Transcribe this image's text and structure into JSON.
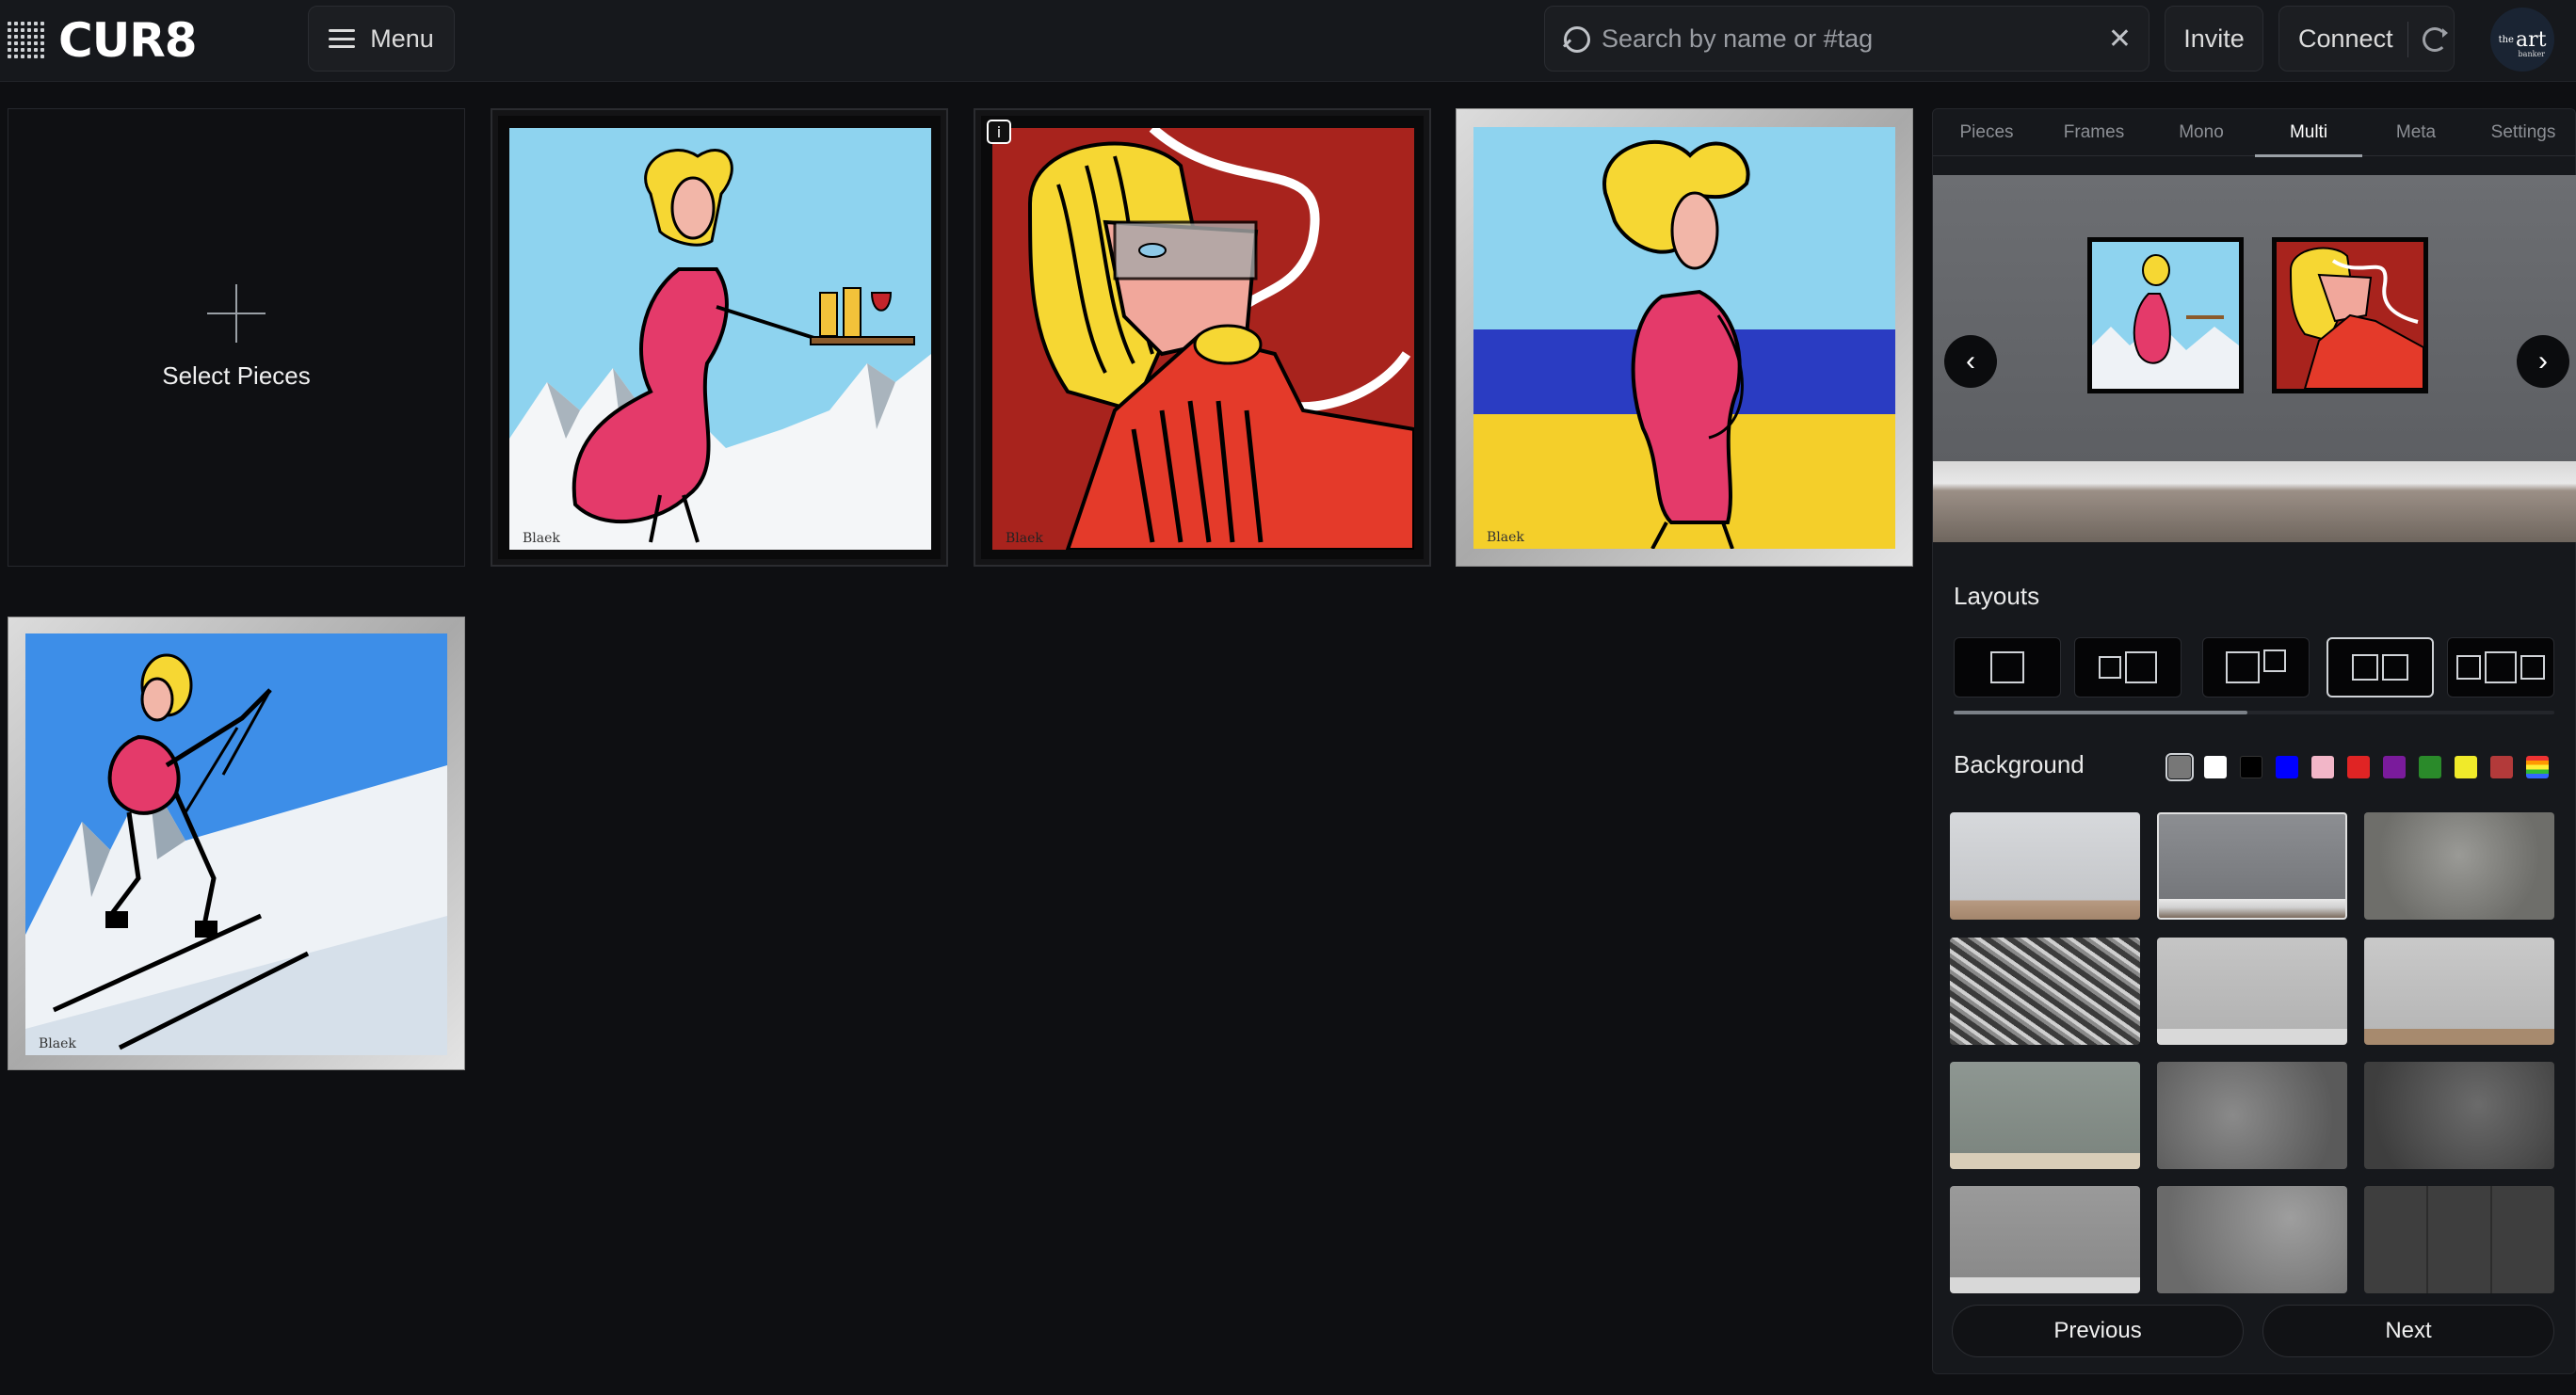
{
  "app": {
    "logo_text": "CUR8"
  },
  "header": {
    "menu_label": "Menu",
    "search_placeholder": "Search by name or #tag",
    "search_value": "",
    "invite_label": "Invite",
    "connect_label": "Connect",
    "avatar": {
      "prefix": "the",
      "word": "art",
      "suffix": "banker"
    }
  },
  "grid": {
    "select_label": "Select Pieces",
    "pieces": [
      {
        "title": "Waitress on slopes",
        "frame": "black"
      },
      {
        "title": "Portrait red collar",
        "frame": "black",
        "info": "i"
      },
      {
        "title": "Woman on beach",
        "frame": "silver"
      },
      {
        "title": "Skier",
        "frame": "silver"
      }
    ]
  },
  "panel": {
    "tabs": [
      "Pieces",
      "Frames",
      "Mono",
      "Multi",
      "Meta",
      "Settings"
    ],
    "active_tab": "Multi",
    "layouts_title": "Layouts",
    "background_title": "Background",
    "swatches": [
      "#777777",
      "#ffffff",
      "#000000",
      "#0000ff",
      "#f2b6c8",
      "#e02424",
      "#7a1b9c",
      "#2a8a2a",
      "#f0ea2a",
      "#b33a3a",
      "rainbow"
    ],
    "selected_swatch": "#777777",
    "previous_label": "Previous",
    "next_label": "Next",
    "prev_icon": "chevron-left-icon",
    "next_icon": "chevron-right-icon"
  }
}
